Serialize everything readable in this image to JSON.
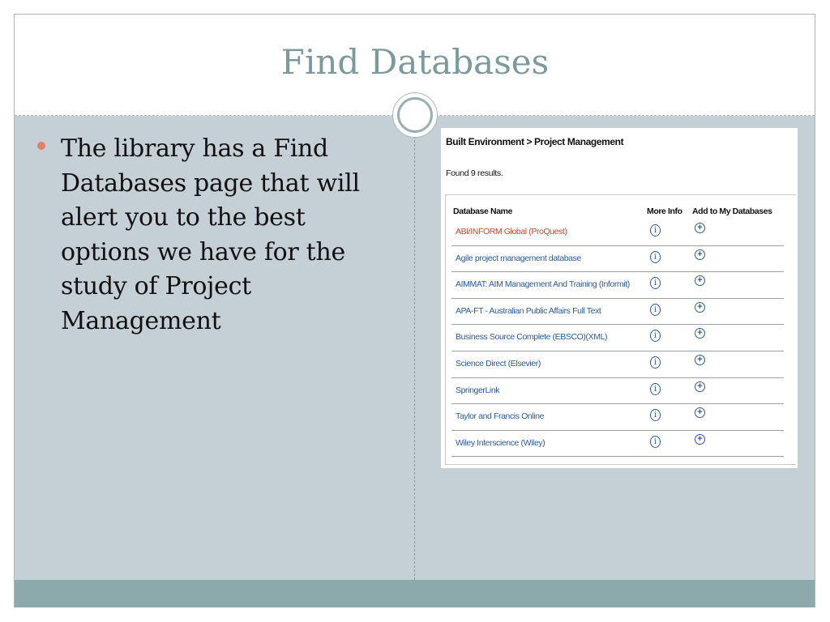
{
  "slide": {
    "title": "Find Databases",
    "bullet_text": "The library has a Find Databases page that will alert you to the best options we have for the study of Project Management"
  },
  "screenshot": {
    "breadcrumb": "Built Environment > Project Management",
    "result_count": "Found 9 results.",
    "columns": {
      "name": "Database Name",
      "info": "More Info",
      "add": "Add to My Databases"
    },
    "rows": [
      {
        "name": "ABI/INFORM Global (ProQuest)",
        "highlight": true
      },
      {
        "name": "Agile project management database"
      },
      {
        "name": "AIMMAT: AIM Management And Training (Informit)"
      },
      {
        "name": "APA-FT - Australian Public Affairs Full Text"
      },
      {
        "name": "Business Source Complete (EBSCO)(XML)"
      },
      {
        "name": "Science Direct (Elsevier)"
      },
      {
        "name": "SpringerLink"
      },
      {
        "name": "Taylor and Francis Online"
      },
      {
        "name": "Wiley Interscience (Wiley)"
      }
    ],
    "info_icon_glyph": "i",
    "add_icon_glyph": "+"
  },
  "colors": {
    "title": "#7c999c",
    "panel": "#c5d0d6",
    "footer": "#8caaac",
    "bullet": "#e1806d",
    "link": "#2a5aa0",
    "link_highlight": "#d0452d"
  }
}
